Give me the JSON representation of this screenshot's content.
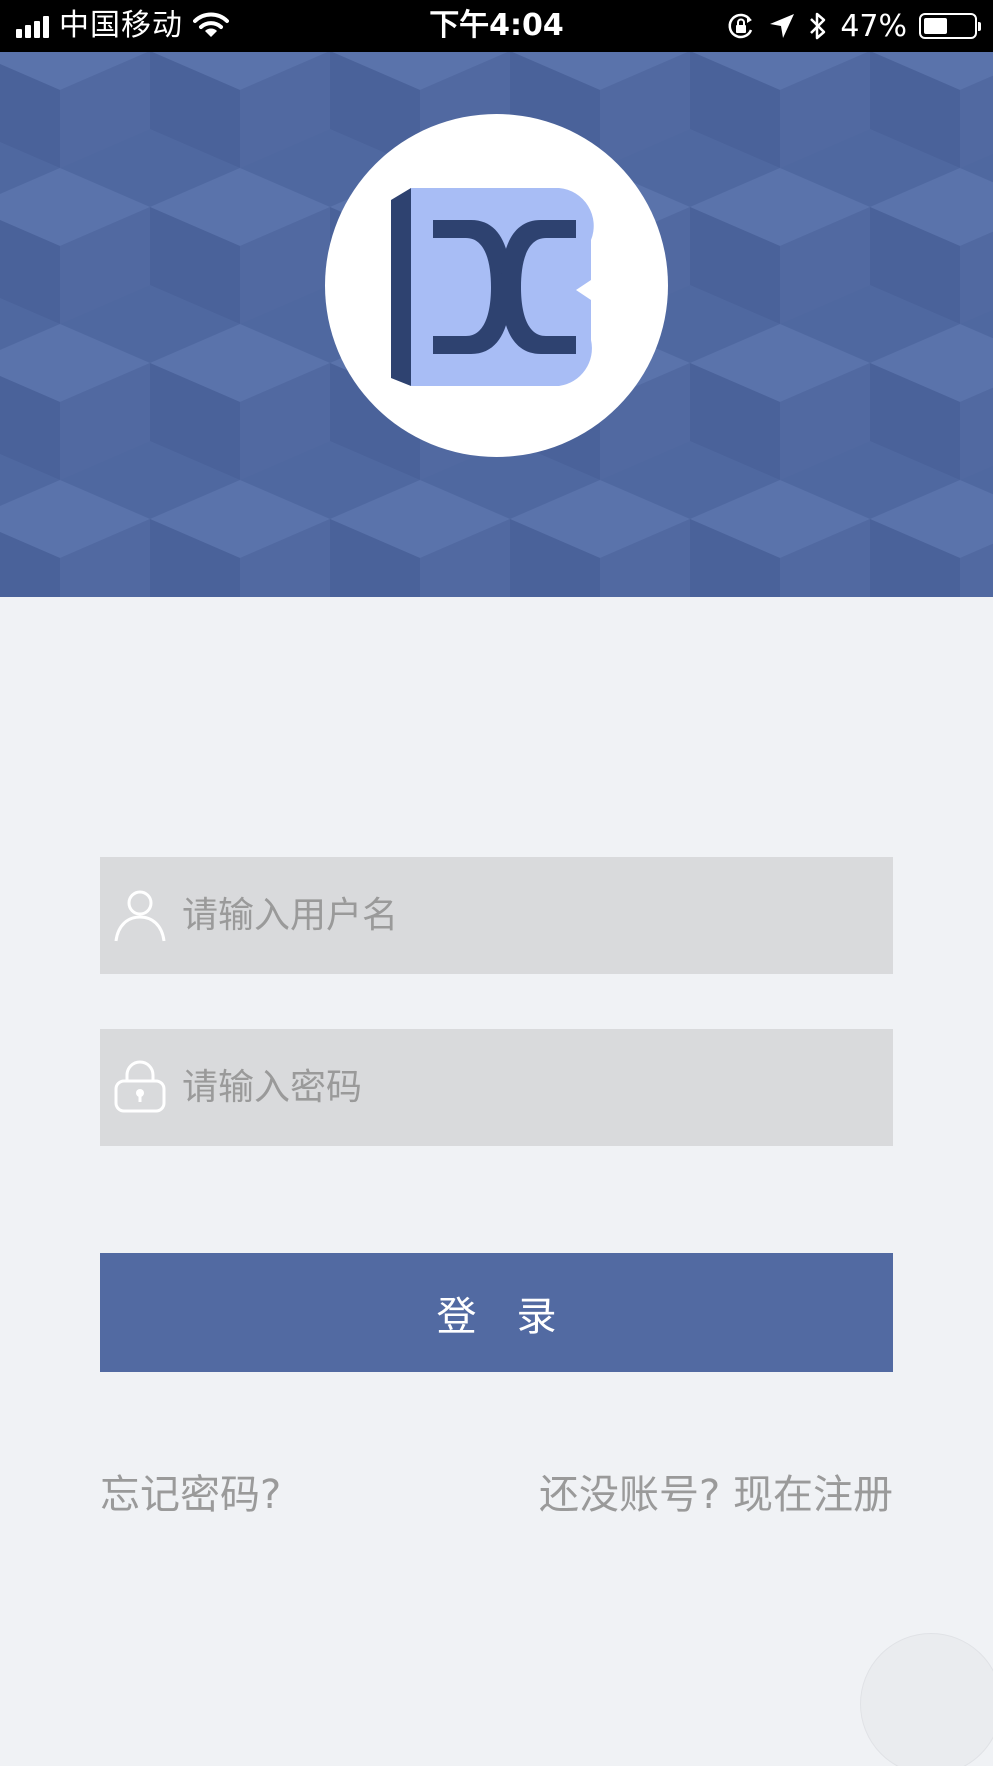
{
  "status_bar": {
    "carrier": "中国移动",
    "time": "下午4:04",
    "battery_percent": "47%",
    "battery_level": 0.47
  },
  "colors": {
    "brand_blue": "#526aa2",
    "logo_light": "#a8bdf5",
    "logo_dark": "#2e4270",
    "field_bg": "#d9dadc",
    "page_bg": "#f0f2f5"
  },
  "icons": {
    "username": "user-icon",
    "password": "lock-icon",
    "logo": "app-logo"
  },
  "form": {
    "username_placeholder": "请输入用户名",
    "username_value": "",
    "password_placeholder": "请输入密码",
    "password_value": "",
    "login_label": "登录"
  },
  "links": {
    "forgot_password": "忘记密码?",
    "register": "还没账号? 现在注册"
  }
}
